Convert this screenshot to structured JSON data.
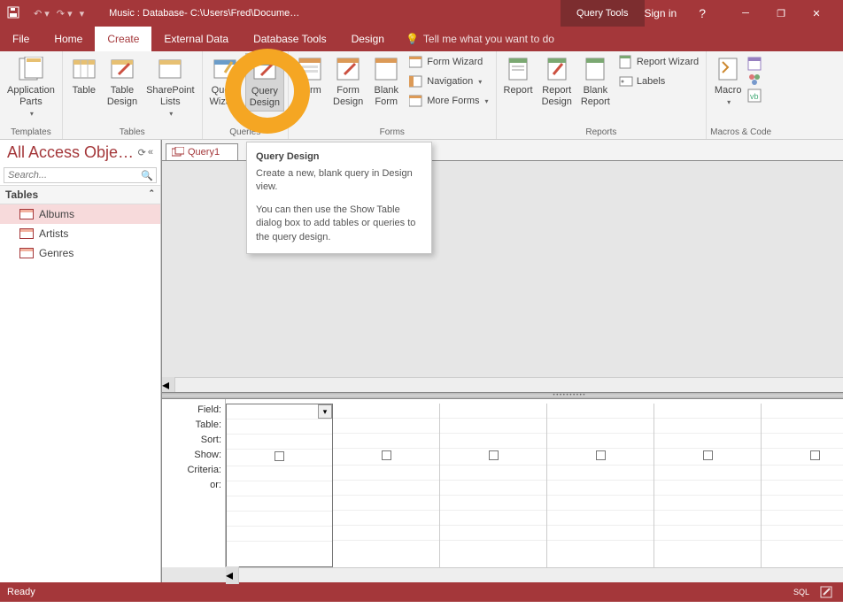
{
  "title_bar": {
    "app_title": "Music : Database- C:\\Users\\Fred\\Docume…",
    "context_tab": "Query Tools",
    "sign_in": "Sign in"
  },
  "menu": {
    "file": "File",
    "home": "Home",
    "create": "Create",
    "external_data": "External Data",
    "database_tools": "Database Tools",
    "design": "Design",
    "tell_me": "Tell me what you want to do"
  },
  "ribbon": {
    "templates": {
      "label": "Templates",
      "application_parts": "Application\nParts"
    },
    "tables": {
      "label": "Tables",
      "table": "Table",
      "table_design": "Table\nDesign",
      "sharepoint_lists": "SharePoint\nLists"
    },
    "queries": {
      "label": "Queries",
      "query_wizard": "Query\nWizard",
      "query_design": "Query\nDesign"
    },
    "forms": {
      "label": "Forms",
      "form": "Form",
      "form_design": "Form\nDesign",
      "blank_form": "Blank\nForm",
      "form_wizard": "Form Wizard",
      "navigation": "Navigation",
      "more_forms": "More Forms"
    },
    "reports": {
      "label": "Reports",
      "report": "Report",
      "report_design": "Report\nDesign",
      "blank_report": "Blank\nReport",
      "report_wizard": "Report Wizard",
      "labels": "Labels"
    },
    "macros_code": {
      "label": "Macros & Code",
      "macro": "Macro"
    }
  },
  "tooltip": {
    "title": "Query Design",
    "p1": "Create a new, blank query in Design view.",
    "p2": "You can then use the Show Table dialog box to add tables or queries to the query design."
  },
  "nav": {
    "title": "All Access Obje…",
    "search_placeholder": "Search...",
    "section_tables": "Tables",
    "items": [
      {
        "label": "Albums",
        "selected": true
      },
      {
        "label": "Artists",
        "selected": false
      },
      {
        "label": "Genres",
        "selected": false
      }
    ]
  },
  "document": {
    "tab_label": "Query1"
  },
  "qbe": {
    "rows": [
      "Field:",
      "Table:",
      "Sort:",
      "Show:",
      "Criteria:",
      "or:"
    ]
  },
  "status": {
    "ready": "Ready",
    "sql": "SQL"
  }
}
